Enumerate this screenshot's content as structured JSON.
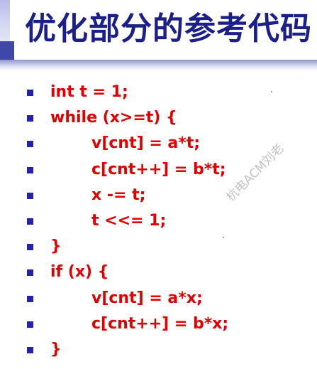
{
  "slide": {
    "title": "优化部分的参考代码",
    "watermark": "杭电ACM刘老",
    "accent_color": "#1b1f8a",
    "code_color": "#e00000",
    "bullet_color": "#2222aa"
  },
  "code": {
    "lines": [
      {
        "text": "int t = 1;",
        "indent": false
      },
      {
        "text": "while (x>=t) {",
        "indent": false
      },
      {
        "text": "v[cnt] = a*t;",
        "indent": true
      },
      {
        "text": "c[cnt++] = b*t;",
        "indent": true
      },
      {
        "text": "x -= t;",
        "indent": true
      },
      {
        "text": "t <<= 1;",
        "indent": true
      },
      {
        "text": "}",
        "indent": false
      },
      {
        "text": "if (x) {",
        "indent": false
      },
      {
        "text": "v[cnt] = a*x;",
        "indent": true
      },
      {
        "text": "c[cnt++] = b*x;",
        "indent": true
      },
      {
        "text": "}",
        "indent": false
      }
    ]
  }
}
